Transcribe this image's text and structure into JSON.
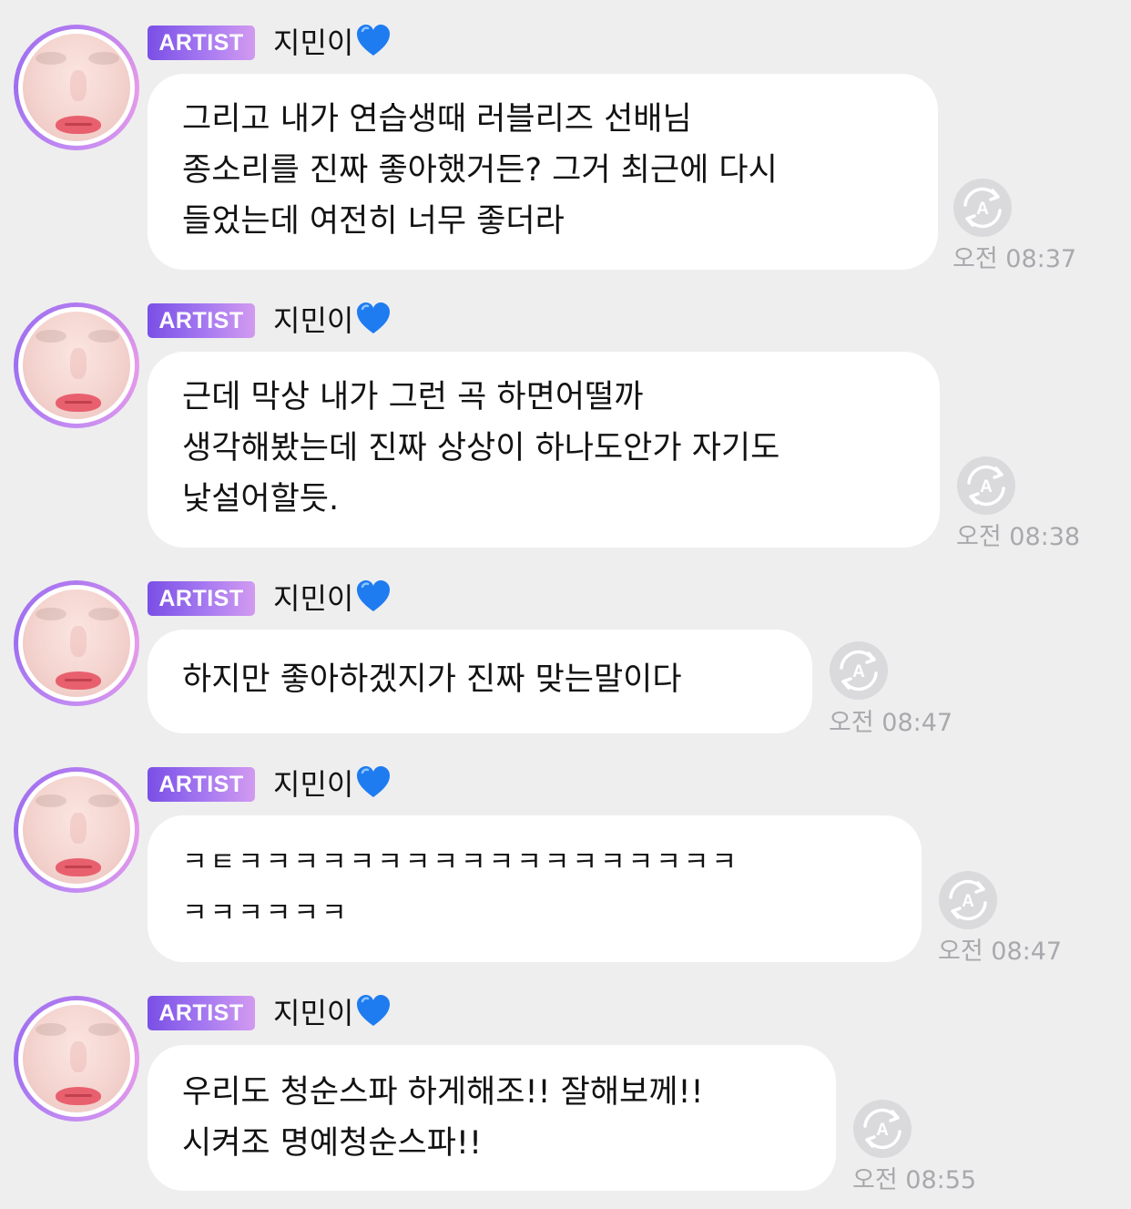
{
  "messages": [
    {
      "badge": "ARTIST",
      "sender": "지민이",
      "text": "그리고 내가 연습생때 러블리즈 선배님\n종소리를 진짜 좋아했거든? 그거 최근에 다시\n들었는데 여전히 너무 좋더라",
      "time": "오전 08:37"
    },
    {
      "badge": "ARTIST",
      "sender": "지민이",
      "text": "근데 막상 내가 그런 곡 하면어떨까\n생각해봤는데 진짜 상상이 하나도안가 자기도\n낯설어할듯.",
      "time": "오전 08:38"
    },
    {
      "badge": "ARTIST",
      "sender": "지민이",
      "text": "하지만 좋아하겠지가 진짜 맞는말이다",
      "time": "오전 08:47"
    },
    {
      "badge": "ARTIST",
      "sender": "지민이",
      "text": "ㅋㅌㅋㅋㅋㅋㅋㅋㅋㅋㅋㅋㅋㅋㅋㅋㅋㅋㅋㅋ\nㅋㅋㅋㅋㅋㅋ",
      "time": "오전 08:47"
    },
    {
      "badge": "ARTIST",
      "sender": "지민이",
      "text": "우리도 청순스파 하게해조!! 잘해보께!!\n시켜조 명예청순스파!!",
      "time": "오전 08:55"
    }
  ],
  "icons": {
    "heart": "blue-heart-emoji",
    "translate": "auto-translate-icon"
  },
  "colors": {
    "background": "#eeeeef",
    "bubble": "#ffffff",
    "badge_start": "#7a4fe6",
    "badge_end": "#d29af0",
    "heart": "#1e7cf0",
    "time": "#a9a9ad"
  }
}
